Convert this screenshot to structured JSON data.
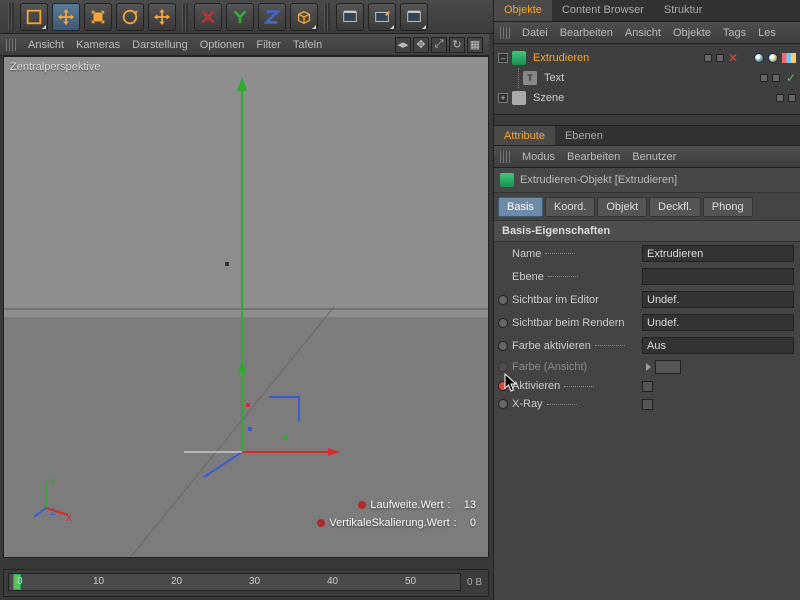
{
  "toolbar": {
    "tools": [
      "select",
      "move",
      "scale",
      "rotate",
      "uniform",
      "x-axis",
      "y-axis",
      "z-axis",
      "cube",
      "render-image",
      "render-region",
      "render-settings"
    ]
  },
  "view_menu": {
    "items": [
      "Ansicht",
      "Kameras",
      "Darstellung",
      "Optionen",
      "Filter",
      "Tafeln"
    ],
    "label": "Zentralperspektive"
  },
  "hud": [
    {
      "label": "Laufweite.Wert",
      "value": "13"
    },
    {
      "label": "VertikaleSkalierung.Wert",
      "value": "0"
    }
  ],
  "timeline": {
    "ticks": [
      "0",
      "10",
      "20",
      "30",
      "40",
      "50"
    ],
    "readout": "0 B"
  },
  "right_tabs_top": {
    "items": [
      "Objekte",
      "Content Browser",
      "Struktur"
    ],
    "active": 0
  },
  "object_menu": {
    "items": [
      "Datei",
      "Bearbeiten",
      "Ansicht",
      "Objekte",
      "Tags",
      "Les"
    ]
  },
  "hierarchy": [
    {
      "name": "Extrudieren",
      "selected": true
    },
    {
      "name": "Text"
    },
    {
      "name": "Szene"
    }
  ],
  "attr_tabs": {
    "items": [
      "Attribute",
      "Ebenen"
    ],
    "active": 0
  },
  "attr_menu": {
    "items": [
      "Modus",
      "Bearbeiten",
      "Benutzer"
    ]
  },
  "attr_head": "Extrudieren-Objekt [Extrudieren]",
  "sub_tabs": {
    "items": [
      "Basis",
      "Koord.",
      "Objekt",
      "Deckfl.",
      "Phong"
    ],
    "active": 0
  },
  "section_title": "Basis-Eigenschaften",
  "props": {
    "name_label": "Name",
    "name_value": "Extrudieren",
    "ebene_label": "Ebene",
    "vis_editor_label": "Sichtbar im Editor",
    "vis_editor_value": "Undef.",
    "vis_render_label": "Sichtbar beim Rendern",
    "vis_render_value": "Undef.",
    "color_enable_label": "Farbe aktivieren",
    "color_enable_value": "Aus",
    "color_view_label": "Farbe (Ansicht)",
    "enable_label": "Aktivieren",
    "xray_label": "X-Ray"
  }
}
